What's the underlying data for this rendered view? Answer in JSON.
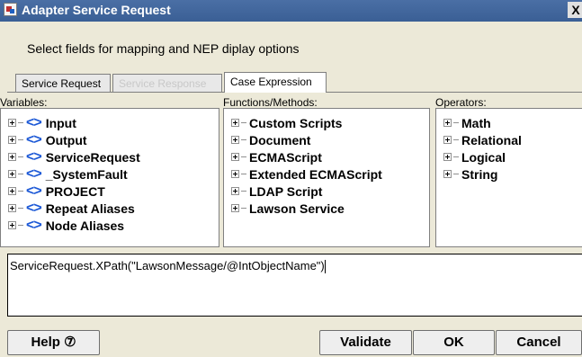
{
  "window": {
    "title": "Adapter Service Request",
    "close_label": "X"
  },
  "instruction": "Select fields for mapping and NEP diplay options",
  "tabs": [
    {
      "label": "Service Request",
      "state": "normal"
    },
    {
      "label": "Service Response",
      "state": "disabled"
    },
    {
      "label": "Case Expression",
      "state": "active"
    }
  ],
  "panes": {
    "variables": {
      "label": "Variables:",
      "items": [
        "Input",
        "Output",
        "ServiceRequest",
        "_SystemFault",
        "PROJECT",
        "Repeat Aliases",
        "Node Aliases"
      ]
    },
    "functions": {
      "label": "Functions/Methods:",
      "items": [
        "Custom Scripts",
        "Document",
        "ECMAScript",
        "Extended ECMAScript",
        "LDAP Script",
        "Lawson Service"
      ]
    },
    "operators": {
      "label": "Operators:",
      "items": [
        "Math",
        "Relational",
        "Logical",
        "String"
      ]
    }
  },
  "expression": "ServiceRequest.XPath(\"LawsonMessage/@IntObjectName\")",
  "buttons": {
    "help": "Help ⑦",
    "validate": "Validate",
    "ok": "OK",
    "cancel": "Cancel"
  },
  "colors": {
    "title_bar": "#3f649c",
    "variable_icon": "#1a57d6",
    "dialog_bg": "#ece9d8"
  },
  "icons": {
    "variable": "angle-brackets-icon",
    "expand": "plus-box-icon"
  }
}
